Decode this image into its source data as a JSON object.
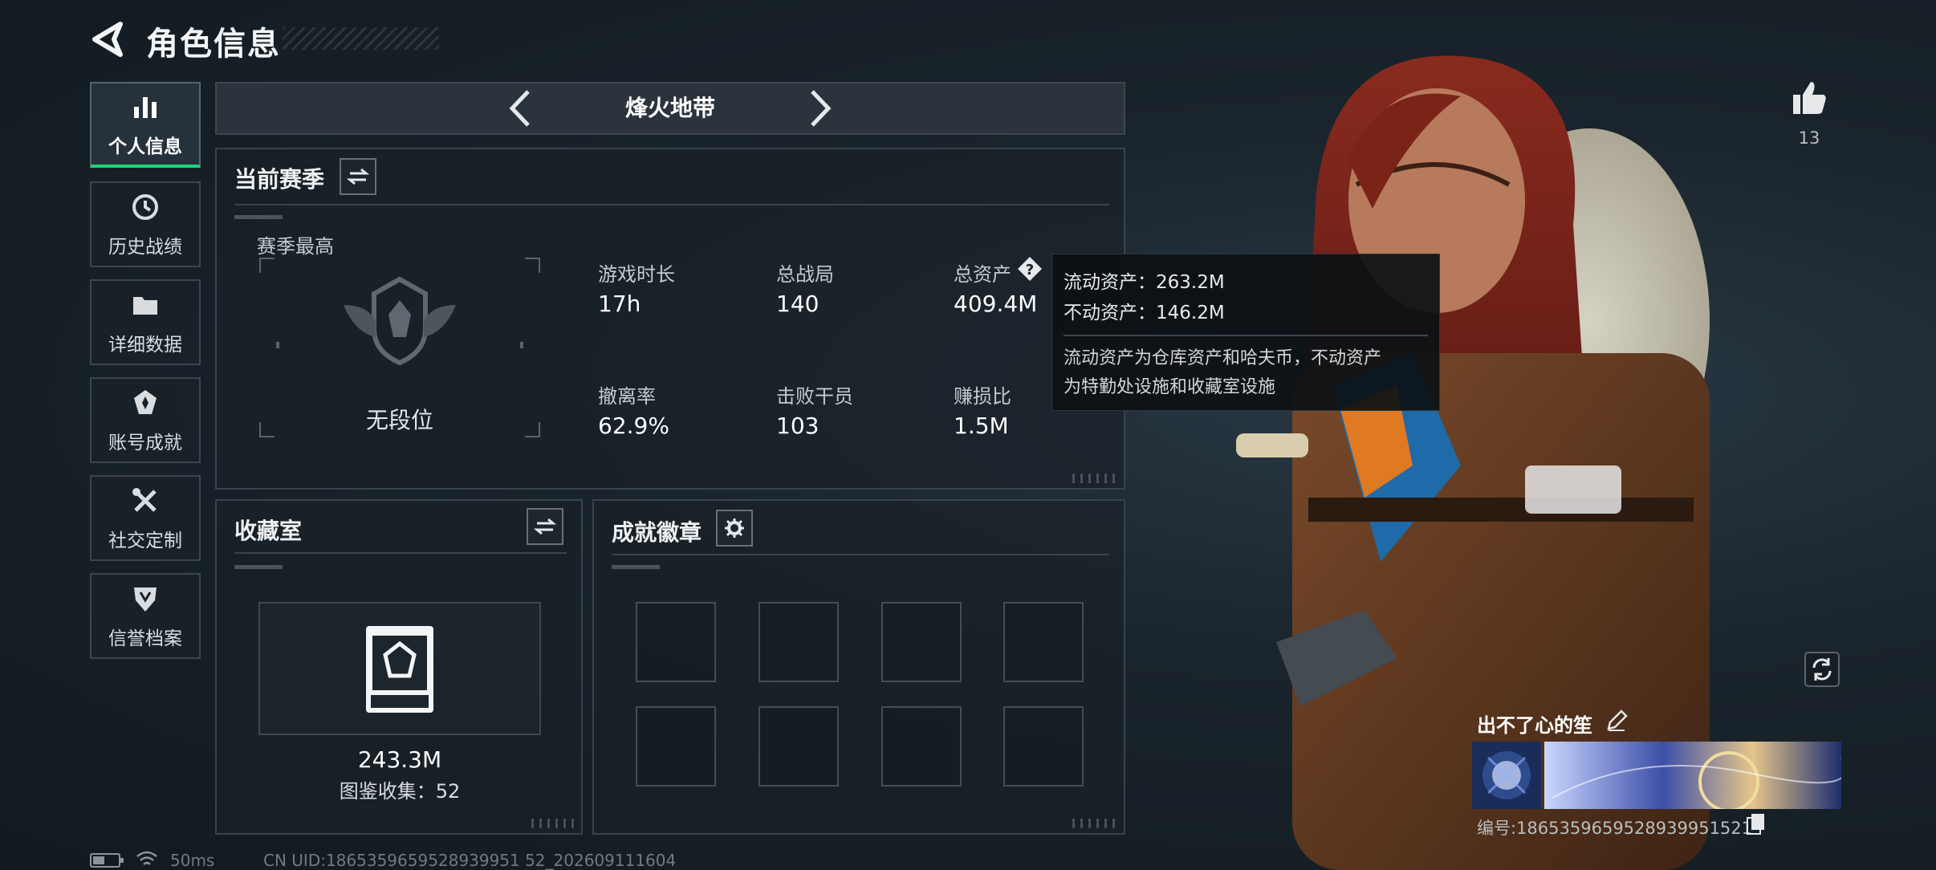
{
  "header": {
    "title": "角色信息"
  },
  "sidebar": {
    "items": [
      {
        "label": "个人信息",
        "icon": "bar-chart-icon",
        "active": true
      },
      {
        "label": "历史战绩",
        "icon": "history-clock-icon"
      },
      {
        "label": "详细数据",
        "icon": "folder-icon"
      },
      {
        "label": "账号成就",
        "icon": "medal-icon"
      },
      {
        "label": "社交定制",
        "icon": "tools-icon"
      },
      {
        "label": "信誉档案",
        "icon": "shield-icon"
      }
    ]
  },
  "mode": {
    "label": "烽火地带"
  },
  "season": {
    "title": "当前赛季",
    "best_label": "赛季最高",
    "rank_label": "无段位",
    "stats": [
      {
        "label": "游戏时长",
        "value": "17h"
      },
      {
        "label": "总战局",
        "value": "140"
      },
      {
        "label": "总资产",
        "value": "409.4M"
      },
      {
        "label": "撤离率",
        "value": "62.9%"
      },
      {
        "label": "击败干员",
        "value": "103"
      },
      {
        "label": "赚损比",
        "value": "1.5M"
      }
    ]
  },
  "tooltip": {
    "liquid": "流动资产：263.2M",
    "fixed": "不动资产：146.2M",
    "desc_line1": "流动资产为仓库资产和哈夫币，不动资产",
    "desc_line2": "为特勤处设施和收藏室设施"
  },
  "collection": {
    "title": "收藏室",
    "value": "243.3M",
    "catalog": "图鉴收集：52"
  },
  "achievements": {
    "title": "成就徽章",
    "slot_count": 8
  },
  "character": {
    "likes": "13",
    "name": "出不了心的笙",
    "id": "编号:1865359659528939951521"
  },
  "status_bar": {
    "ping": "50ms",
    "uid": "CN UID:1865359659528939951 52_202609111604"
  },
  "colors": {
    "accent": "#1fd37a",
    "panel_border": "#39434c"
  }
}
